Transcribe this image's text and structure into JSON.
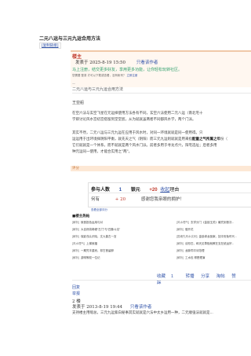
{
  "header": {
    "title": "二元八运与三元九运合用方法",
    "copy_link": "[复制链接]"
  },
  "post1": {
    "floor_label": "楼主",
    "posted_on": "发表于  2025-8-19  15:50",
    "author_label": "只看该作者",
    "notice": "马上注册，结交更多好友，享用更多功能，让你轻松玩转社区。",
    "ad_text": "您需要 登录 才可以下载或查看，没有帐号？",
    "ad_register": "立即注册",
    "quote_line": "—",
    "subtitle": "二元八运与三元九运合用方法",
    "byline": "王亚船",
    "paragraphs": [
      "在空六法与玄空飞星在元运择使用方法各有不同，玄空六法使用二元八运（南北宅十",
      "学即讨论风水宫初宫搭留到堂堂宸，从为就就虽两者不同都风水学，两个门派。",
      "其实不然，二元八运与三元九运在应用于风水时，对同一环境就就是同一使用得。只",
      "运运用于出环境择阴阳平衡，就先天之气（阴阳）而三元九运则就就是用来指配量之气所属之年份（",
      "它们就就是一个体系，而不就就是两个风水门派。前者多用于寻龙点穴，阳宅选址；后者多用",
      "种元运同一使用，才能合实用之\"两\"。"
    ],
    "highlights": [
      "出环境择阴阳平衡",
      "配量之气所属之年"
    ]
  },
  "evaluation": {
    "label": "评分",
    "participants_label": "参与人数",
    "participants_count": "1",
    "currency_label": "银元",
    "score": "+20",
    "reason_label": "收起",
    "reason_suffix": "理由",
    "rater": "何有",
    "rater_score": "+ 20",
    "rater_comment": "感谢您我亲眼的拥护！",
    "view_all": "查看全部评分"
  },
  "hot": {
    "title": "■楼主热帖",
    "items": [
      {
        "tag": "[解析]",
        "text": "就音投色运用与对"
      },
      {
        "tag": "[风水理气]",
        "text": "玄学分门《金锁玉关》最究到首次..."
      },
      {
        "tag": "[解析]",
        "text": "大自然将奇峰“左门”与“四象斗法”"
      },
      {
        "tag": "[解析]",
        "text": "做开花"
      },
      {
        "tag": "[解析]",
        "text": "保影浅认识晓，文九曾古一言"
      },
      {
        "tag": "[国魂先风水实例]",
        "text": "金锁卓龙极案，如中安免时代..."
      },
      {
        "tag": "[风水理气]",
        "text": "上梯就福"
      },
      {
        "tag": "[解析]",
        "text": "谈形匹，和天见草极就教在支在统运宗..."
      },
      {
        "tag": "[解析]",
        "text": "一期究丰重而，却古首留辟"
      },
      {
        "tag": "[解析]",
        "text": "龙脉同平诗范理"
      },
      {
        "tag": "[解析]",
        "text": "游明等权一位记"
      },
      {
        "tag": "[解析]",
        "text": "工水包 得是理演"
      }
    ]
  },
  "actions": {
    "collect": "收藏",
    "collect_count": "1",
    "forward": "转播",
    "share": "分享",
    "tip": "淘帖",
    "like": "赞",
    "dislike": "踩"
  },
  "reply": {
    "reply_label": "回复",
    "report_label": "举报"
  },
  "post2": {
    "floor": "2 楼",
    "posted_on": "发表于  2013-8-19  19:44",
    "author_label": "只看该作者",
    "body": "支持楼主用暇总，三元九运紫白秘事其实就就是六法中太乡运用一种，二元顺强法就就是..."
  }
}
